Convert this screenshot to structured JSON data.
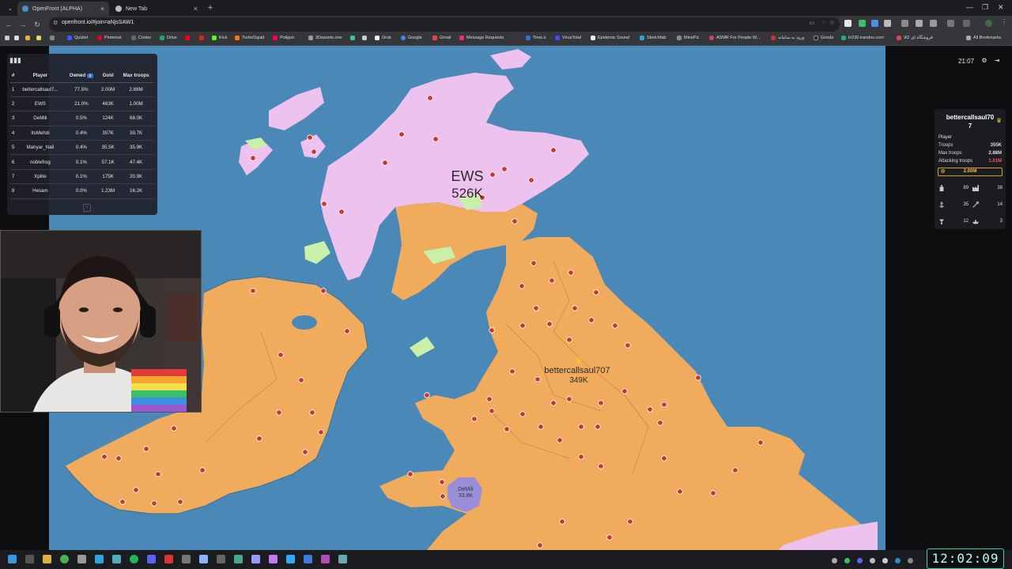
{
  "browser": {
    "tabs": [
      {
        "title": "OpenFront (ALPHA)",
        "active": true
      },
      {
        "title": "New Tab",
        "active": false
      }
    ],
    "url": "openfront.io/#join=aNjsSAW1",
    "bookmarks": [
      "Quizlet",
      "Pinterest",
      "Cooler",
      "Drive",
      "",
      "Kick",
      "TurboSquid",
      "Poligon",
      "3Dassets.one",
      "",
      "Grok",
      "Google",
      "Gmail",
      "Message Requests",
      "Time.ir",
      "VirusTotal",
      "Epidemic Sound",
      "Sketchfab",
      "MinePic",
      "ASMR For People W...",
      "ورود به سامانه",
      "Goods",
      "ln230.irandns.com",
      "فروشگاه ای کالا"
    ],
    "all_bookmarks": "All Bookmarks"
  },
  "leaderboard": {
    "headers": [
      "#",
      "Player",
      "Owned",
      "Gold",
      "Max troops"
    ],
    "rows": [
      {
        "rank": "1",
        "player": "bettercallsaul7...",
        "owned": "77.5%",
        "gold": "2.00M",
        "max_troops": "2.88M"
      },
      {
        "rank": "2",
        "player": "EWS",
        "owned": "21.0%",
        "gold": "463K",
        "max_troops": "1.00M"
      },
      {
        "rank": "3",
        "player": "DeMili",
        "owned": "0.5%",
        "gold": "124K",
        "max_troops": "68.0K"
      },
      {
        "rank": "4",
        "player": "ItsMehdi",
        "owned": "0.4%",
        "gold": "307K",
        "max_troops": "39.7K"
      },
      {
        "rank": "5",
        "player": "Mahyar_Nali",
        "owned": "0.4%",
        "gold": "35.5K",
        "max_troops": "35.9K"
      },
      {
        "rank": "6",
        "player": "noblefrog",
        "owned": "0.1%",
        "gold": "57.1K",
        "max_troops": "47.4K"
      },
      {
        "rank": "7",
        "player": "Xplite",
        "owned": "0.1%",
        "gold": "175K",
        "max_troops": "20.9K"
      },
      {
        "rank": "8",
        "player": "Hesam",
        "owned": "0.0%",
        "gold": "1.23M",
        "max_troops": "16.2K"
      }
    ],
    "collapse_label": "-"
  },
  "hud": {
    "game_time": "21:07"
  },
  "player_panel": {
    "name": "bettercallsaul70",
    "name_line2": "7",
    "type": "Player",
    "troops_label": "Troops",
    "troops": "355K",
    "max_troops_label": "Max troops",
    "max_troops": "2.88M",
    "attacking_label": "Attacking troops",
    "attacking": "1.01M",
    "gold": "2.00M",
    "stats": [
      "89",
      "38",
      "35",
      "14",
      "12",
      "3"
    ]
  },
  "map_labels": {
    "ews_name": "EWS",
    "ews_troops": "526K",
    "player_name": "bettercallsaul707",
    "player_troops": "349K",
    "demili_name": "DeMili",
    "demili_troops": "33.8K"
  },
  "colors": {
    "ocean": "#4a88b8",
    "player_territory": "#f0ac5c",
    "ews_territory": "#eec2ee",
    "demili_territory": "#9b8ed8",
    "neutral_island": "#c8f0a8",
    "city_marker": "#c8372b"
  },
  "taskbar": {
    "clock": "12:02:09"
  }
}
